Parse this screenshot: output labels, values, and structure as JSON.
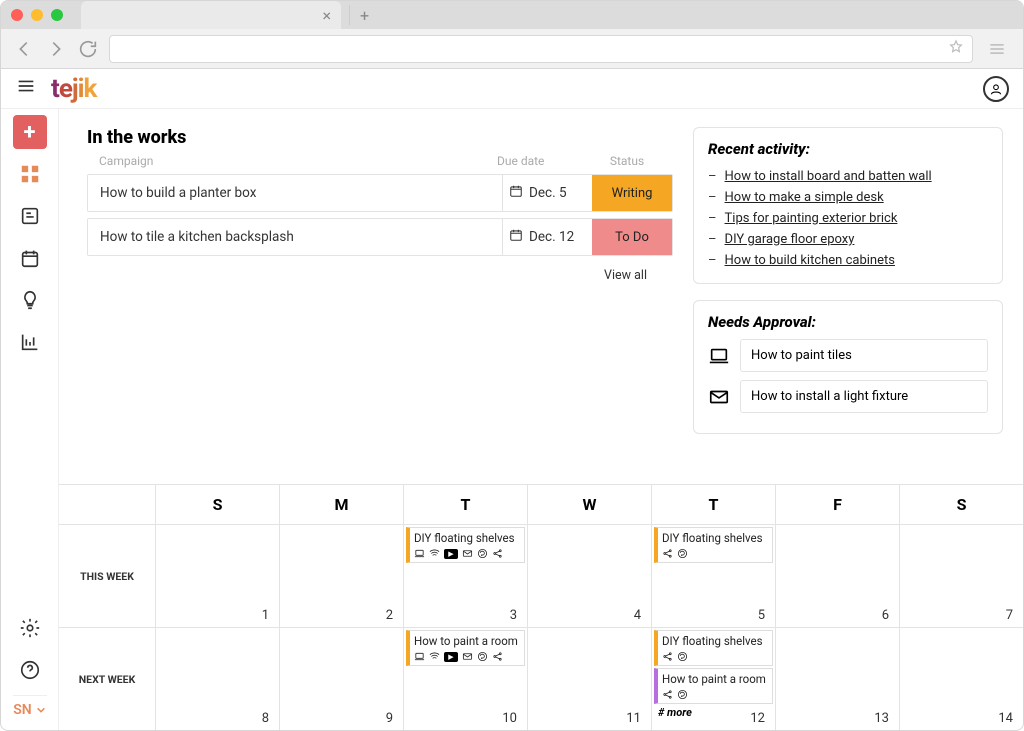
{
  "browser": {
    "tab_close": "×",
    "new_tab": "+"
  },
  "header": {
    "logo": {
      "t": "t",
      "e": "e",
      "j": "j",
      "i": "i",
      "k": "k"
    }
  },
  "sidebar": {
    "user_initials": "SN"
  },
  "works": {
    "title": "In the works",
    "cols": {
      "campaign": "Campaign",
      "due": "Due date",
      "status": "Status"
    },
    "rows": [
      {
        "name": "How to build a planter box",
        "due": "Dec. 5",
        "status": "Writing",
        "status_class": "status-writing"
      },
      {
        "name": "How to tile a kitchen backsplash",
        "due": "Dec. 12",
        "status": "To Do",
        "status_class": "status-todo"
      }
    ],
    "viewall": "View all"
  },
  "recent": {
    "title": "Recent activity:",
    "items": [
      "How to install board and batten wall",
      "How to make a simple desk",
      "Tips for painting exterior brick",
      "DIY garage floor epoxy",
      "How to build kitchen cabinets"
    ]
  },
  "approval": {
    "title": "Needs Approval:",
    "items": [
      {
        "icon": "laptop",
        "label": "How to paint tiles"
      },
      {
        "icon": "mail",
        "label": "How to install a light fixture"
      }
    ]
  },
  "calendar": {
    "days": [
      "S",
      "M",
      "T",
      "W",
      "T",
      "F",
      "S"
    ],
    "week_labels": [
      "THIS WEEK",
      "NEXT WEEK"
    ],
    "week1": {
      "dates": [
        "1",
        "2",
        "3",
        "4",
        "5",
        "6",
        "7"
      ],
      "events": {
        "2": [
          {
            "title": "DIY floating shelves",
            "color": "orange",
            "icons": "full"
          }
        ],
        "4": [
          {
            "title": "DIY floating shelves",
            "color": "orange",
            "icons": "share"
          }
        ]
      }
    },
    "week2": {
      "dates": [
        "8",
        "9",
        "10",
        "11",
        "12",
        "13",
        "14"
      ],
      "events": {
        "2": [
          {
            "title": "How to paint a room",
            "color": "orange",
            "icons": "full"
          }
        ],
        "4": [
          {
            "title": "DIY floating shelves",
            "color": "orange",
            "icons": "share"
          },
          {
            "title": "How to paint a room",
            "color": "purple",
            "icons": "share"
          }
        ]
      },
      "more": "# more"
    }
  }
}
